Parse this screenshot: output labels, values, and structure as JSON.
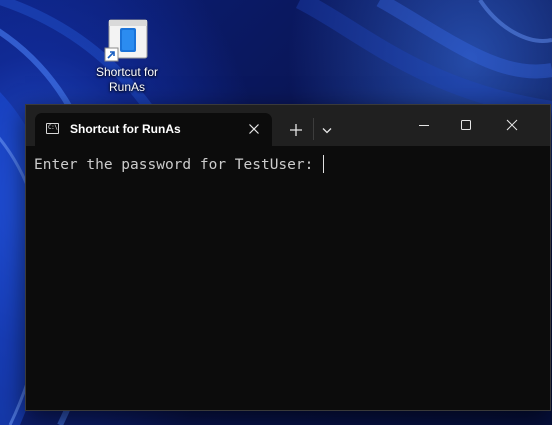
{
  "desktop": {
    "shortcut_label_line1": "Shortcut for",
    "shortcut_label_line2": "RunAs"
  },
  "window": {
    "tab_title": "Shortcut for RunAs",
    "tab_icon_text": "C:\\",
    "icons": {
      "tab_close": "close-icon",
      "new_tab": "plus-icon",
      "dropdown": "chevron-down-icon",
      "minimize": "minimize-icon",
      "maximize": "maximize-icon",
      "close": "close-icon"
    }
  },
  "terminal": {
    "prompt_text": "Enter the password for TestUser: "
  },
  "colors": {
    "terminal_bg": "#0c0c0c",
    "titlebar_bg": "#202020",
    "text": "#cccccc",
    "desktop_accent": "#1e56e0"
  }
}
